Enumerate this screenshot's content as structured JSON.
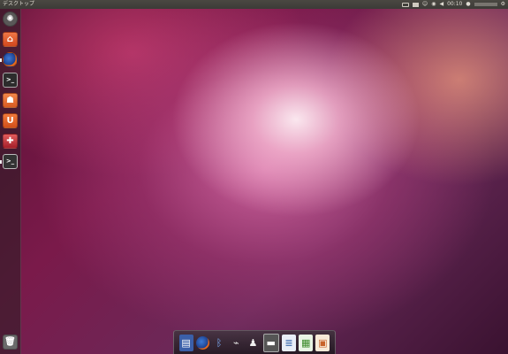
{
  "panel": {
    "title": "デスクトップ",
    "clock": "00:10"
  },
  "colors": {
    "panel_bg": "#3c3b37",
    "launcher_bg": "rgba(40,30,35,0.55)",
    "wallpaper_accent": "#c8518a"
  },
  "launcher": {
    "items": [
      {
        "name": "dash-home-icon"
      },
      {
        "name": "home-folder-icon"
      },
      {
        "name": "firefox-icon"
      },
      {
        "name": "terminal-icon"
      },
      {
        "name": "software-center-icon"
      },
      {
        "name": "ubuntu-one-icon"
      },
      {
        "name": "system-tools-icon"
      },
      {
        "name": "terminal-window-icon"
      },
      {
        "name": "trash-icon"
      }
    ]
  },
  "dock": {
    "items": [
      {
        "name": "save-disk-icon"
      },
      {
        "name": "firefox-icon"
      },
      {
        "name": "bluetooth-icon"
      },
      {
        "name": "usb-cable-icon"
      },
      {
        "name": "penguin-icon"
      },
      {
        "name": "scanner-icon"
      },
      {
        "name": "text-document-icon"
      },
      {
        "name": "spreadsheet-icon"
      },
      {
        "name": "presentation-icon"
      }
    ]
  }
}
